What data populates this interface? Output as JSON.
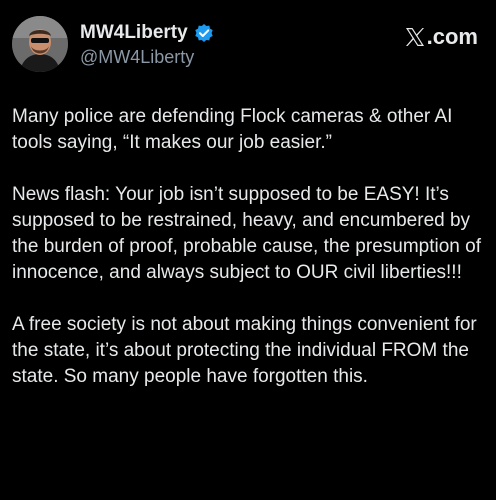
{
  "author": {
    "display_name": "MW4Liberty",
    "handle": "@MW4Liberty",
    "verified": true,
    "verified_color": "#1d9bf0",
    "avatar_icon": "profile-photo"
  },
  "source": {
    "logo_icon": "x-logo-icon",
    "domain": ".com"
  },
  "tweet": {
    "paragraphs": [
      "Many police are defending Flock cameras & other AI tools saying, “It makes our job easier.”",
      "News flash:  Your job isn’t supposed to be EASY! It’s supposed to be restrained, heavy, and encumbered by the burden of proof, probable cause, the presumption of innocence, and always subject to OUR civil liberties!!!",
      "A free society is not about making things convenient for the state, it’s about protecting the individual FROM the state. So many people have forgotten this."
    ]
  },
  "colors": {
    "background": "#000000",
    "text": "#e7e9ea",
    "secondary_text": "#8b98a5"
  }
}
